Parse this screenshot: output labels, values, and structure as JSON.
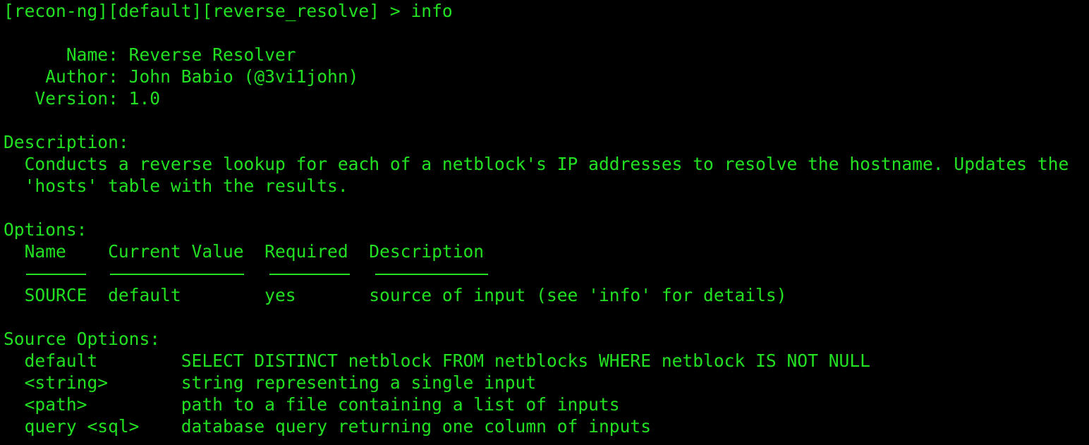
{
  "prompt": {
    "text": "[recon-ng][default][reverse_resolve] > ",
    "command": "info"
  },
  "info": {
    "name_line": "      Name: Reverse Resolver",
    "author_line": "    Author: John Babio (@3vi1john)",
    "version_line": "   Version: 1.0"
  },
  "description": {
    "heading": "Description:",
    "lines": [
      "  Conducts a reverse lookup for each of a netblock's IP addresses to resolve the hostname. Updates the",
      "  'hosts' table with the results."
    ]
  },
  "options": {
    "heading": "Options:",
    "header_line": "  Name    Current Value  Required  Description",
    "rows": [
      "  SOURCE  default        yes       source of input (see 'info' for details)"
    ]
  },
  "source_options": {
    "heading": "Source Options:",
    "rows": [
      "  default        SELECT DISTINCT netblock FROM netblocks WHERE netblock IS NOT NULL",
      "  <string>       string representing a single input",
      "  <path>         path to a file containing a list of inputs",
      "  query <sql>    database query returning one column of inputs"
    ]
  }
}
